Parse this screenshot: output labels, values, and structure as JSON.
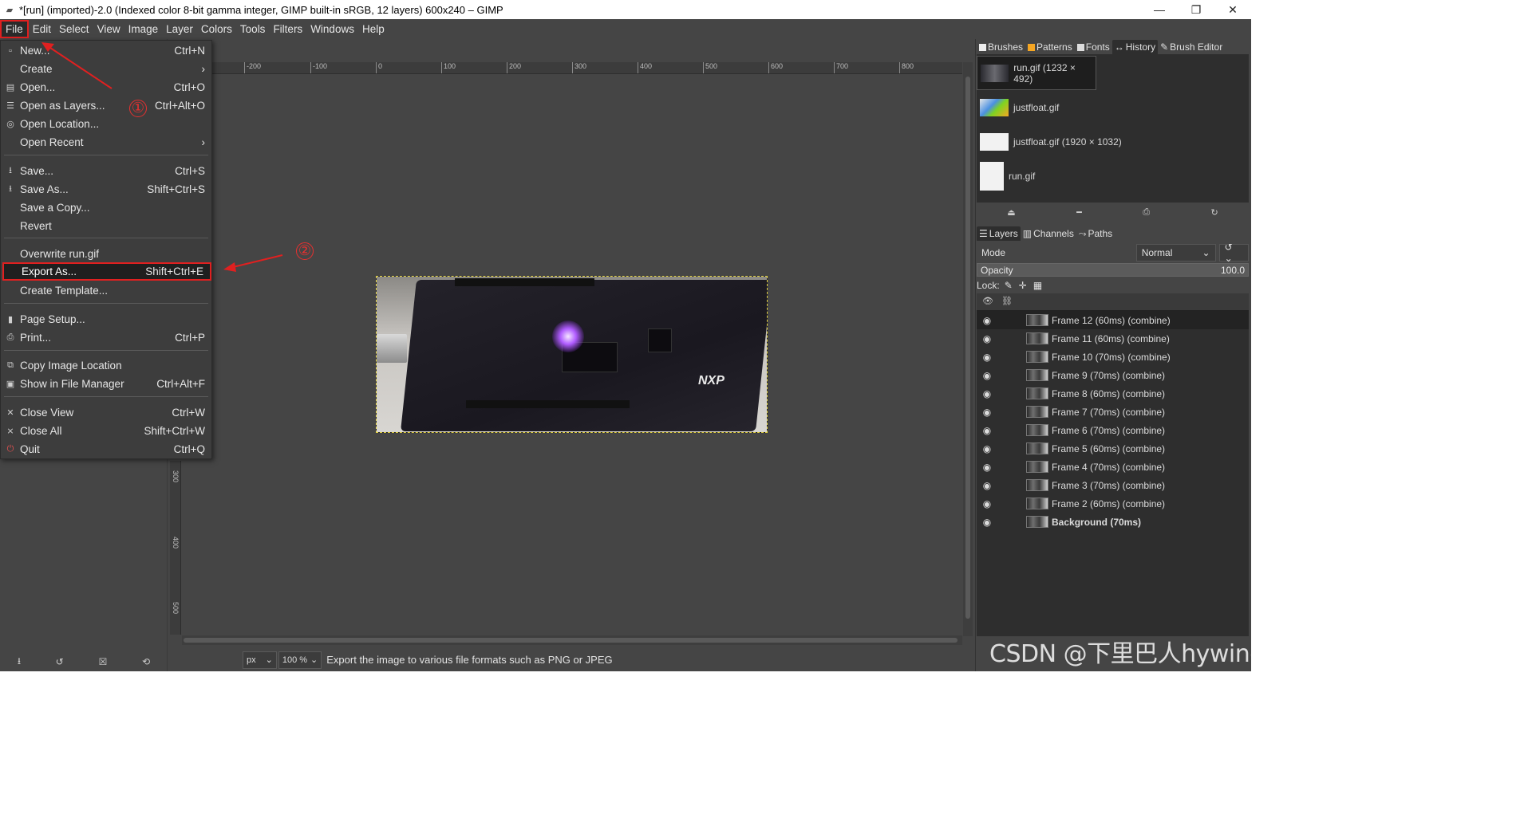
{
  "window": {
    "title": "*[run] (imported)-2.0 (Indexed color 8-bit gamma integer, GIMP built-in sRGB, 12 layers) 600x240 – GIMP",
    "controls": [
      "—",
      "❐",
      "✕"
    ]
  },
  "menubar": [
    "File",
    "Edit",
    "Select",
    "View",
    "Image",
    "Layer",
    "Colors",
    "Tools",
    "Filters",
    "Windows",
    "Help"
  ],
  "file_menu": [
    {
      "label": "New...",
      "shortcut": "Ctrl+N",
      "icon": "new-icon"
    },
    {
      "label": "Create",
      "shortcut": "›",
      "icon": ""
    },
    {
      "label": "Open...",
      "shortcut": "Ctrl+O",
      "icon": "open-icon"
    },
    {
      "label": "Open as Layers...",
      "shortcut": "Ctrl+Alt+O",
      "icon": "open-layers-icon"
    },
    {
      "label": "Open Location...",
      "shortcut": "",
      "icon": "globe-icon"
    },
    {
      "label": "Open Recent",
      "shortcut": "›",
      "icon": ""
    },
    {
      "label": "Save...",
      "shortcut": "Ctrl+S",
      "icon": "save-icon"
    },
    {
      "label": "Save As...",
      "shortcut": "Shift+Ctrl+S",
      "icon": "save-as-icon"
    },
    {
      "label": "Save a Copy...",
      "shortcut": "",
      "icon": ""
    },
    {
      "label": "Revert",
      "shortcut": "",
      "icon": ""
    },
    {
      "label": "Overwrite run.gif",
      "shortcut": "",
      "icon": ""
    },
    {
      "label": "Export As...",
      "shortcut": "Shift+Ctrl+E",
      "icon": ""
    },
    {
      "label": "Create Template...",
      "shortcut": "",
      "icon": ""
    },
    {
      "label": "Page Setup...",
      "shortcut": "",
      "icon": "page-icon"
    },
    {
      "label": "Print...",
      "shortcut": "Ctrl+P",
      "icon": "print-icon"
    },
    {
      "label": "Copy Image Location",
      "shortcut": "",
      "icon": "copy-icon"
    },
    {
      "label": "Show in File Manager",
      "shortcut": "Ctrl+Alt+F",
      "icon": "folder-icon"
    },
    {
      "label": "Close View",
      "shortcut": "Ctrl+W",
      "icon": "close-icon"
    },
    {
      "label": "Close All",
      "shortcut": "Shift+Ctrl+W",
      "icon": "close-all-icon"
    },
    {
      "label": "Quit",
      "shortcut": "Ctrl+Q",
      "icon": "quit-icon"
    }
  ],
  "annotations": {
    "step1": "①",
    "step2": "②"
  },
  "ruler_top": [
    "-200",
    "-100",
    "0",
    "100",
    "200",
    "300",
    "400",
    "500",
    "600",
    "700",
    "800"
  ],
  "ruler_left": [
    "300",
    "400",
    "500"
  ],
  "canvas_image_text": {
    "brand": "NXP"
  },
  "statusbar": {
    "unit": "px",
    "zoom": "100 %",
    "message": "Export the image to various file formats such as PNG or JPEG"
  },
  "dock_top_tabs": [
    "Brushes",
    "Patterns",
    "Fonts",
    "History",
    "Brush Editor"
  ],
  "images_list": [
    {
      "label": "run.gif (1232 × 492)"
    },
    {
      "label": "justfloat.gif"
    },
    {
      "label": "justfloat.gif (1920 × 1032)"
    },
    {
      "label": "run.gif"
    }
  ],
  "dock_bottom_tabs": [
    "Layers",
    "Channels",
    "Paths"
  ],
  "layers_controls": {
    "mode_label": "Mode",
    "mode_value": "Normal",
    "opacity_label": "Opacity",
    "opacity_value": "100.0",
    "lock_label": "Lock:"
  },
  "layers": [
    {
      "name": "Frame 12 (60ms) (combine)"
    },
    {
      "name": "Frame 11 (60ms) (combine)"
    },
    {
      "name": "Frame 10 (70ms) (combine)"
    },
    {
      "name": "Frame 9 (70ms) (combine)"
    },
    {
      "name": "Frame 8 (60ms) (combine)"
    },
    {
      "name": "Frame 7 (70ms) (combine)"
    },
    {
      "name": "Frame 6 (70ms) (combine)"
    },
    {
      "name": "Frame 5 (60ms) (combine)"
    },
    {
      "name": "Frame 4 (70ms) (combine)"
    },
    {
      "name": "Frame 3 (70ms) (combine)"
    },
    {
      "name": "Frame 2 (60ms) (combine)"
    },
    {
      "name": "Background (70ms)"
    }
  ],
  "watermark": "CSDN @下里巴人hywing",
  "colors": {
    "highlight": "#e02020",
    "panel": "#454545",
    "list_bg": "#2e2e2e"
  }
}
